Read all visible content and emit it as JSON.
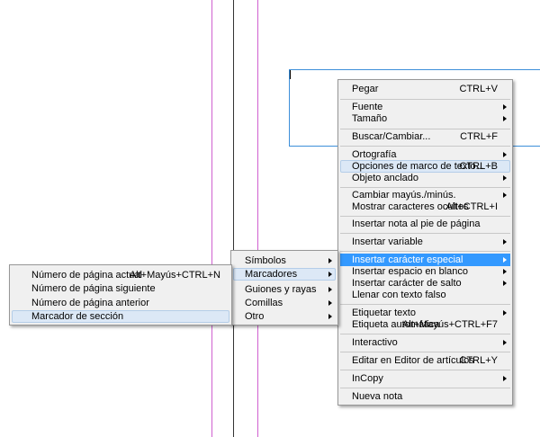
{
  "colors": {
    "guide_magenta": "#d060d0",
    "guide_dark": "#333333",
    "frame_blue": "#3d8fd9",
    "highlight": "#3399ff"
  },
  "context_menu": {
    "items": [
      {
        "label": "Pegar",
        "shortcut": "CTRL+V"
      },
      {
        "label": "Fuente",
        "submenu": true
      },
      {
        "label": "Tamaño",
        "submenu": true
      },
      {
        "label": "Buscar/Cambiar...",
        "shortcut": "CTRL+F"
      },
      {
        "label": "Ortografía",
        "submenu": true
      },
      {
        "label": "Opciones de marco de texto...",
        "shortcut": "CTRL+B"
      },
      {
        "label": "Objeto anclado",
        "submenu": true
      },
      {
        "label": "Cambiar mayús./minús.",
        "submenu": true
      },
      {
        "label": "Mostrar caracteres ocultos",
        "shortcut": "Alt+CTRL+I"
      },
      {
        "label": "Insertar nota al pie de página"
      },
      {
        "label": "Insertar variable",
        "submenu": true
      },
      {
        "label": "Insertar carácter especial",
        "submenu": true
      },
      {
        "label": "Insertar espacio en blanco",
        "submenu": true
      },
      {
        "label": "Insertar carácter de salto",
        "submenu": true
      },
      {
        "label": "Llenar con texto falso"
      },
      {
        "label": "Etiquetar texto",
        "submenu": true
      },
      {
        "label": "Etiqueta automática",
        "shortcut": "Alt+Mayús+CTRL+F7"
      },
      {
        "label": "Interactivo",
        "submenu": true
      },
      {
        "label": "Editar en Editor de artículos",
        "shortcut": "CTRL+Y"
      },
      {
        "label": "InCopy",
        "submenu": true
      },
      {
        "label": "Nueva nota"
      }
    ]
  },
  "special_char_menu": {
    "items": [
      {
        "label": "Símbolos",
        "submenu": true
      },
      {
        "label": "Marcadores",
        "submenu": true
      },
      {
        "label": "Guiones y rayas",
        "submenu": true
      },
      {
        "label": "Comillas",
        "submenu": true
      },
      {
        "label": "Otro",
        "submenu": true
      }
    ]
  },
  "markers_menu": {
    "items": [
      {
        "label": "Número de página actual",
        "shortcut": "Alt+Mayús+CTRL+N"
      },
      {
        "label": "Número de página siguiente"
      },
      {
        "label": "Número de página anterior"
      },
      {
        "label": "Marcador de sección"
      }
    ]
  }
}
